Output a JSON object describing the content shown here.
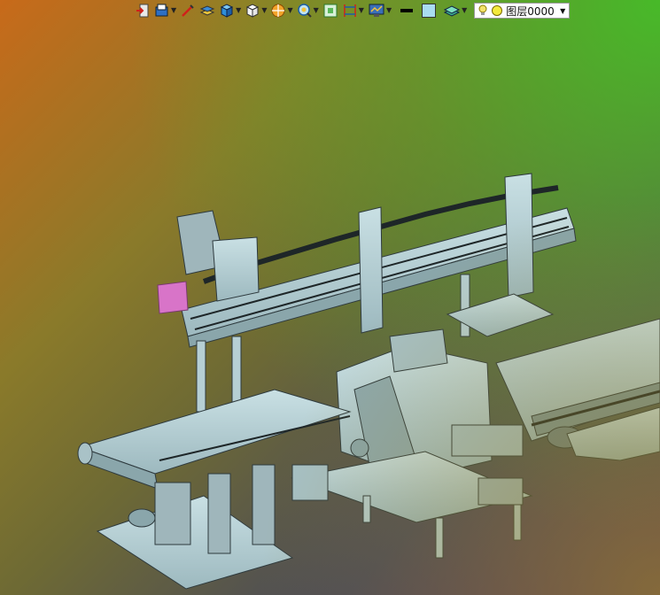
{
  "toolbar": {
    "layer_selector": {
      "selected": "图层0000",
      "bulb_color": "#f3e36a",
      "layer_color": "#f4ea3c"
    },
    "line_color": "#000000",
    "fill_color": "#a9dcf0",
    "buttons": [
      "exit-icon",
      "open-model-icon",
      "sketch-icon",
      "stack-icon",
      "view-cube-icon",
      "wire-cube-icon",
      "section-icon",
      "zoom-icon",
      "frame-icon",
      "dimension-icon",
      "monitor-icon",
      "line-weight-icon",
      "fill-color-icon",
      "layers-icon"
    ]
  },
  "viewport": {
    "background_colors": [
      "#c86a1a",
      "#6e6a34",
      "#5a3066",
      "#4fbf2a"
    ],
    "model_color": "#b6d3d8",
    "accent_part_color": "#d874c8"
  }
}
